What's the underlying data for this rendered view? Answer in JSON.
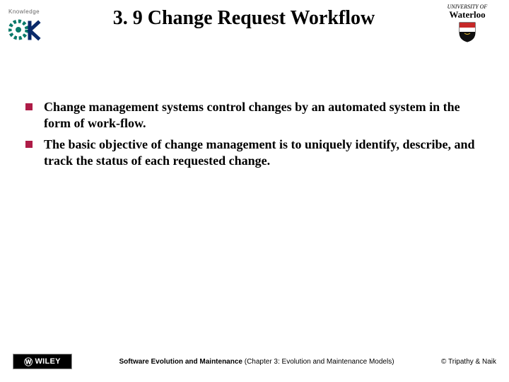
{
  "header": {
    "title": "3. 9 Change Request Workflow",
    "left_logo": {
      "tag": "Knowledge"
    },
    "right_logo": {
      "line1": "UNIVERSITY OF",
      "line2": "Waterloo"
    }
  },
  "bullets": [
    "Change management systems control changes by an automated system in the form of work-flow.",
    "The basic objective of change management is to uniquely identify, describe, and track the status of each requested change."
  ],
  "footer": {
    "publisher": "WILEY",
    "center_bold": "Software Evolution and Maintenance",
    "center_rest": " (Chapter 3: Evolution and Maintenance Models)",
    "right": "© Tripathy & Naik"
  }
}
